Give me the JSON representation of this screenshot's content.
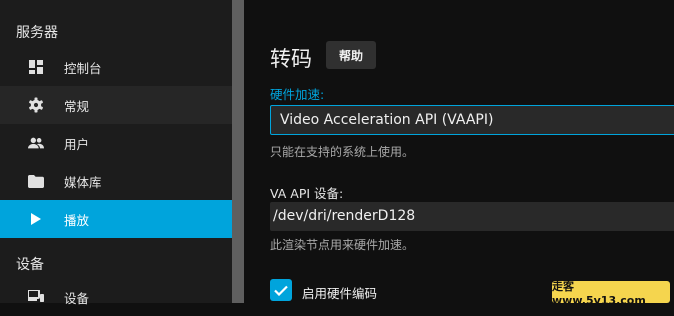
{
  "sidebar": {
    "server_section": "服务器",
    "devices_section": "设备",
    "items": [
      {
        "label": "控制台",
        "icon": "dashboard-icon"
      },
      {
        "label": "常规",
        "icon": "gear-icon"
      },
      {
        "label": "用户",
        "icon": "people-icon"
      },
      {
        "label": "媒体库",
        "icon": "folder-icon"
      },
      {
        "label": "播放",
        "icon": "play-icon"
      },
      {
        "label": "设备",
        "icon": "devices-icon"
      }
    ],
    "active_item": "播放"
  },
  "main": {
    "title": "转码",
    "help_label": "帮助",
    "hw_accel_label": "硬件加速:",
    "hw_accel_value": "Video Acceleration API (VAAPI)",
    "hw_accel_hint": "只能在支持的系统上使用。",
    "va_device_label": "VA API 设备:",
    "va_device_value": "/dev/dri/renderD128",
    "va_device_hint": "此渲染节点用来硬件加速。",
    "hw_encoding_label": "启用硬件编码",
    "hw_encoding_checked": true
  },
  "watermark": "走客 www.5v13.com",
  "colors": {
    "accent": "#00a4dc",
    "background": "#101010",
    "sidebar": "#1c1c1c"
  }
}
